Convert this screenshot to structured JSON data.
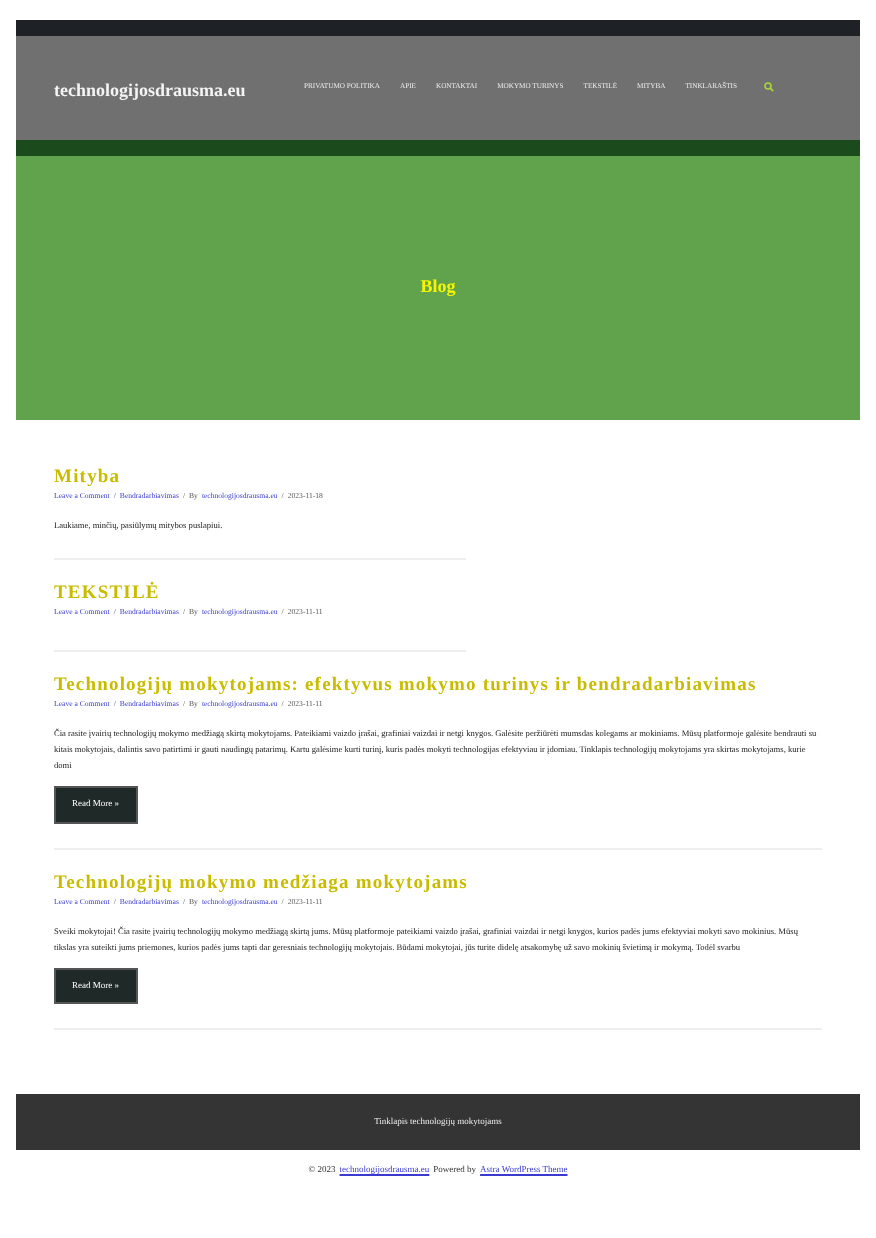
{
  "site_title": "technologijosdrausma.eu",
  "nav": [
    {
      "label": "PRIVATUMO POLITIKA"
    },
    {
      "label": "APIE"
    },
    {
      "label": "KONTAKTAI"
    },
    {
      "label": "MOKYMO TURINYS"
    },
    {
      "label": "TEKSTILĖ"
    },
    {
      "label": "MITYBA"
    },
    {
      "label": "TINKLARAŠTIS"
    }
  ],
  "hero": {
    "title": "Blog"
  },
  "posts": [
    {
      "title": "Mityba",
      "comment": "Leave a Comment",
      "sep": [
        "/",
        "/",
        "/"
      ],
      "category": "Bendradarbiavimas",
      "by": "By",
      "author": "technologijosdrausma.eu",
      "date": "2023-11-18",
      "excerpt": "Laukiame, minčių, pasiūlymų mitybos puslapiui.",
      "wide": false
    },
    {
      "title": "TEKSTILĖ",
      "comment": "Leave a Comment",
      "sep": [
        "/",
        "/",
        "/"
      ],
      "category": "Bendradarbiavimas",
      "by": "By",
      "author": "technologijosdrausma.eu",
      "date": "2023-11-11",
      "wide": false
    },
    {
      "title": "Technologijų mokytojams: efektyvus mokymo turinys ir bendradarbiavimas",
      "comment": "Leave a Comment",
      "sep": [
        "/",
        "/",
        "/"
      ],
      "category": "Bendradarbiavimas",
      "by": "By",
      "author": "technologijosdrausma.eu",
      "date": "2023-11-11",
      "excerpt": "Čia rasite įvairių technologijų mokymo medžiagą skirtą mokytojams. Pateikiami vaizdo įrašai, grafiniai vaizdai ir netgi knygos. Galėsite peržiūrėti mumsdas kolegams ar mokiniams. Mūsų platformoje galėsite bendrauti su kitais mokytojais, dalintis savo patirtimi ir gauti naudingų patarimų. Kartu galėsime kurti turinį, kuris padės mokyti technologijas efektyviau ir įdomiau. Tinklapis technologijų mokytojams yra skirtas mokytojams, kurie domi",
      "read_more": "Read More »",
      "wide": true
    },
    {
      "title": "Technologijų mokymo medžiaga mokytojams",
      "comment": "Leave a Comment",
      "sep": [
        "/",
        "/",
        "/"
      ],
      "category": "Bendradarbiavimas",
      "by": "By",
      "author": "technologijosdrausma.eu",
      "date": "2023-11-11",
      "excerpt": "Sveiki mokytojai! Čia rasite įvairių technologijų mokymo medžiagą skirtą jums. Mūsų platformoje pateikiami vaizdo įrašai, grafiniai vaizdai ir netgi knygos, kurios padės jums efektyviai mokyti savo mokinius. Mūsų tikslas yra suteikti jums priemones, kurios padės jums tapti dar geresniais technologijų mokytojais. Būdami mokytojai, jūs turite didelę atsakomybę už savo mokinių švietimą ir mokymą. Todėl svarbu",
      "read_more": "Read More »",
      "wide": true
    }
  ],
  "footer_bar": {
    "text": "Tinklapis technologijų mokytojams"
  },
  "copyright": {
    "prefix": "© 2023",
    "site": "technologijosdrausma.eu",
    "powered": "Powered by",
    "theme": "Astra WordPress Theme"
  }
}
